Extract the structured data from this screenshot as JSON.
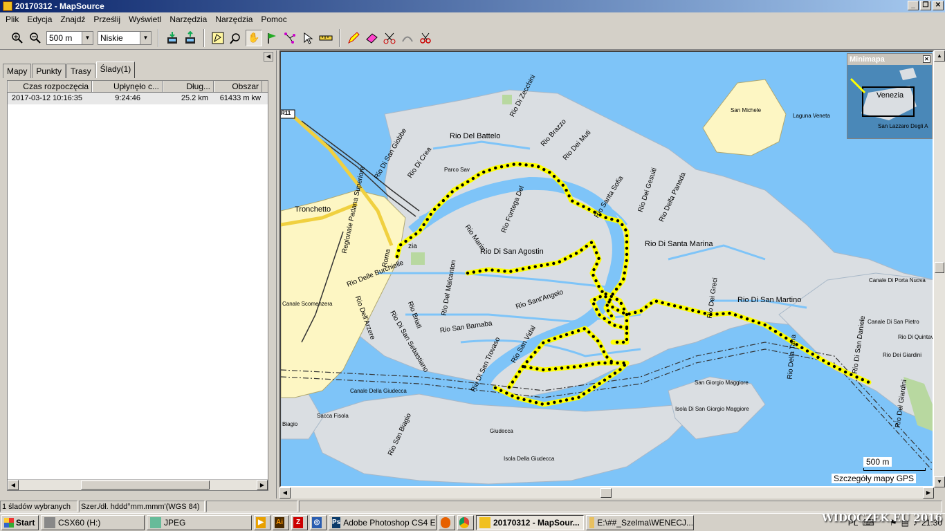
{
  "window": {
    "title": "20170312 - MapSource"
  },
  "menu": [
    "Plik",
    "Edycja",
    "Znajdź",
    "Prześlij",
    "Wyświetl",
    "Narzędzia",
    "Narzędzia",
    "Pomoc"
  ],
  "toolbar": {
    "zoom_value": "500 m",
    "detail_value": "Niskie"
  },
  "left": {
    "tabs": [
      "Mapy",
      "Punkty",
      "Trasy",
      "Ślady(1)"
    ],
    "columns": [
      "Czas rozpoczęcia",
      "Upłynęło c...",
      "Dług...",
      "Obszar"
    ],
    "rows": [
      {
        "start": "2017-03-12 10:16:35",
        "elapsed": "9:24:46",
        "length": "25.2 km",
        "area": "61433 m kw"
      }
    ]
  },
  "map": {
    "labels": {
      "rio_del_battelo": "Rio Del Battelo",
      "rio_di_zecchini": "Rio Di Zecchini",
      "rio_brazzo": "Rio Brazzo",
      "rio_dei_muti": "Rio Dei Muti",
      "rio_di_san_giobbe": "Rio Di San Giobbe",
      "rio_di_crea": "Rio Di Crea",
      "parco_savorgnan": "Parco Sav",
      "san_michele": "San Michele",
      "laguna_veneta": "Laguna Veneta",
      "rio_santa_sofia": "Rio Santa Sofia",
      "rio_dei_gesuiti": "Rio Dei Gesuiti",
      "rio_della_panada": "Rio Della Panada",
      "tronchetto": "Tronchetto",
      "regionale": "Regionale Padana Superiore",
      "rio_marin": "Rio Marin",
      "rio_fontega": "Rio Fontega Del",
      "rio_di_san_agostin": "Rio Di San Agostin",
      "rio_di_santa_marina": "Rio Di Santa Marina",
      "roma": "Roma",
      "venezia": "zia",
      "rio_delle_burchielle": "Rio Delle Burchielle",
      "rio_del_malcanton": "Rio Del Malcanton",
      "canale_scomenzera": "Canale Scomenzera",
      "rio_dellarzere": "Rio Dell'Arzere",
      "rio_briati": "Rio Briati",
      "rio_di_san_sebastiano": "Rio Di San Sebastiano",
      "rio_santangelo": "Rio Sant'Angelo",
      "rio_san_barnaba": "Rio San Barnaba",
      "rio_di_san_trovaso": "Rio Di San Trovaso",
      "rio_san_vidal": "Rio San Vidal",
      "rio_di_san_martino": "Rio Di San Martino",
      "canale_porta_nuova": "Canale Di Porta Nuova",
      "canale_san_pietro": "Canale Di San Pietro",
      "rio_di_quintavalle": "Rio Di Quintav",
      "rio_dei_giardini": "Rio Dei Giardini",
      "rio_dei_greci": "Rio Dei Greci",
      "rio_di_san_daniele": "Rio Di San Daniele",
      "rio_dei_giardini2": "Rio Dei Giardini",
      "rio_della_tana": "Rio Della Tana",
      "san_giorgio_maggiore": "San Giorgio Maggiore",
      "isola_san_giorgio": "Isola Di San Giorgio Maggiore",
      "canale_giudecca": "Canale Della Giudecca",
      "sacca_fisola": "Sacca Fisola",
      "rio_san_biagio": "Rio San Biagio",
      "giudecca": "Giudecca",
      "isola_giudecca": "Isola Della Giudecca",
      "biagio": "Biagio",
      "route_r11": "R11"
    },
    "minimap": {
      "title": "Minimapa",
      "city": "Venezia",
      "place": "San Lazzaro Degli A"
    },
    "scale": "500 m",
    "details": "Szczegóły mapy GPS"
  },
  "status": {
    "selected": "1 śladów wybranych",
    "coords": "Szer./dł. hddd°mm.mmm'(WGS 84)"
  },
  "taskbar": {
    "start": "Start",
    "items": [
      "CSX60 (H:)",
      "JPEG",
      "Adobe Photoshop CS4 E...",
      "20170312 - MapSour...",
      "E:\\##_Szelma\\WENECJ..."
    ],
    "lang": "PL",
    "time": "21:30",
    "watermark": "WIDOCZEK.EU 2016"
  },
  "colors": {
    "water": "#7ec4f8",
    "land": "#dadee2",
    "track": "#ffff00",
    "rail_land": "#fdf6c3"
  }
}
